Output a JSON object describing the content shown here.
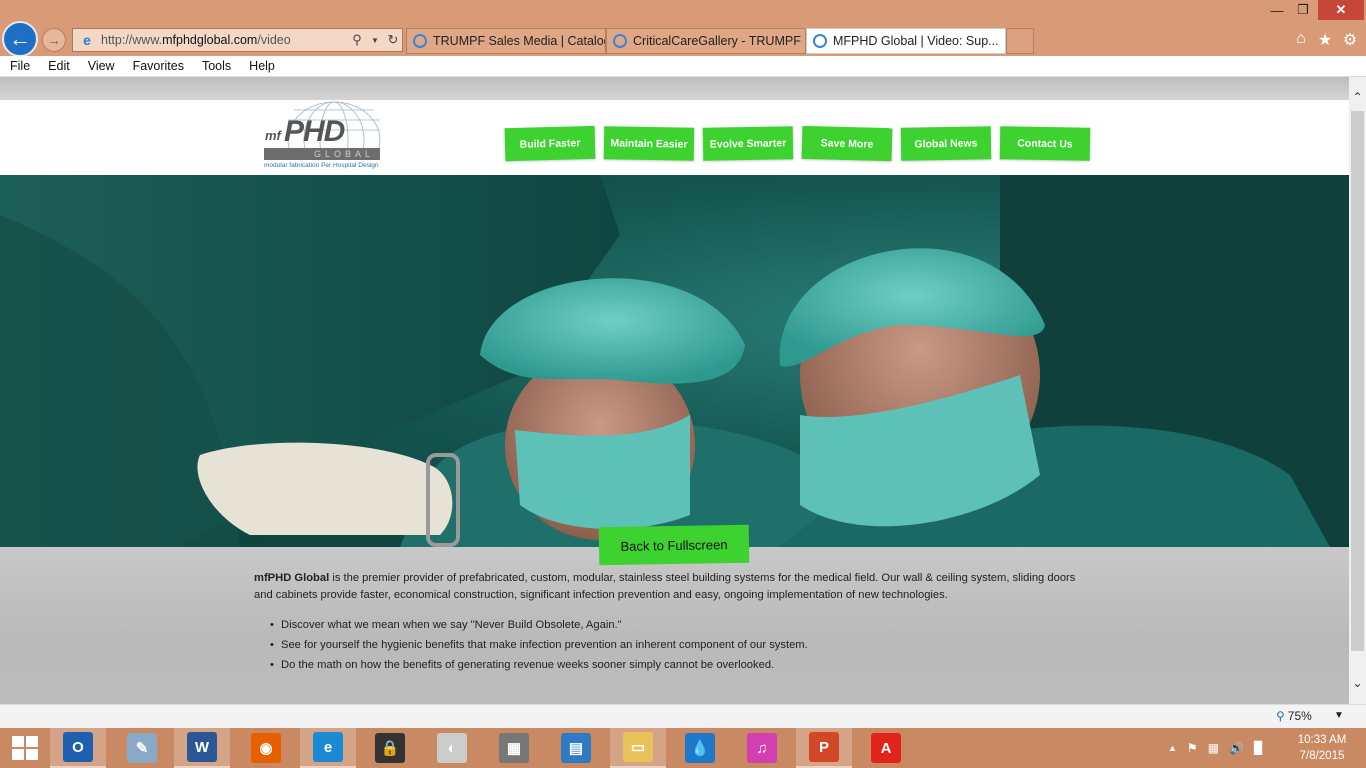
{
  "browser": {
    "url_prefix": "http://www.",
    "url_domain": "mfphdglobal.com",
    "url_path": "/video",
    "tabs": [
      {
        "label": "TRUMPF Sales Media | Catalog"
      },
      {
        "label": "CriticalCareGallery - TRUMPF ..."
      },
      {
        "label": "MFPHD Global | Video: Sup..."
      }
    ],
    "menu": [
      "File",
      "Edit",
      "View",
      "Favorites",
      "Tools",
      "Help"
    ],
    "zoom": "75%"
  },
  "site": {
    "logo": {
      "mf": "mf",
      "phd": "PHD",
      "global": "GLOBAL",
      "tagline": "modular fabrication Per Hospital Design"
    },
    "nav": [
      {
        "label": "Build Faster"
      },
      {
        "label": "Maintain Easier"
      },
      {
        "label": "Evolve Smarter"
      },
      {
        "label": "Save More"
      },
      {
        "label": "Global News"
      },
      {
        "label": "Contact Us"
      }
    ],
    "back_to_fullscreen": "Back to Fullscreen",
    "intro_brand": "mfPHD Global",
    "intro_text": " is the premier provider of prefabricated, custom, modular, stainless steel building systems for the medical field. Our wall & ceiling system, sliding doors and cabinets provide faster, economical construction, significant infection prevention and easy, ongoing implementation of new technologies.",
    "bullets": [
      "Discover what we mean when we say \"Never Build Obsolete, Again.\"",
      "See for yourself the hygienic benefits that make infection prevention an inherent component of our system.",
      "Do the math on how the benefits of generating revenue weeks sooner simply cannot be overlooked."
    ]
  },
  "taskbar": {
    "time": "10:33 AM",
    "date": "7/8/2015",
    "apps": [
      {
        "name": "outlook-icon",
        "glyph": "O",
        "color": "#1f5fb0"
      },
      {
        "name": "paint-icon",
        "glyph": "✎",
        "color": "#8aa8c8"
      },
      {
        "name": "word-icon",
        "glyph": "W",
        "color": "#2b5797"
      },
      {
        "name": "firefox-icon",
        "glyph": "◉",
        "color": "#e66000"
      },
      {
        "name": "internet-explorer-icon",
        "glyph": "e",
        "color": "#1b8ad3"
      },
      {
        "name": "lock-icon",
        "glyph": "🔒",
        "color": "#333333"
      },
      {
        "name": "dragon-icon",
        "glyph": "◐",
        "color": "#cccccc"
      },
      {
        "name": "wall-icon",
        "glyph": "▦",
        "color": "#777777"
      },
      {
        "name": "control-panel-icon",
        "glyph": "▤",
        "color": "#2e7bc4"
      },
      {
        "name": "file-explorer-icon",
        "glyph": "▭",
        "color": "#e8c25a"
      },
      {
        "name": "water-drop-icon",
        "glyph": "💧",
        "color": "#1d78c9"
      },
      {
        "name": "itunes-icon",
        "glyph": "♫",
        "color": "#d33fb1"
      },
      {
        "name": "powerpoint-icon",
        "glyph": "P",
        "color": "#d24726"
      },
      {
        "name": "acrobat-icon",
        "glyph": "A",
        "color": "#e2231a"
      }
    ]
  }
}
